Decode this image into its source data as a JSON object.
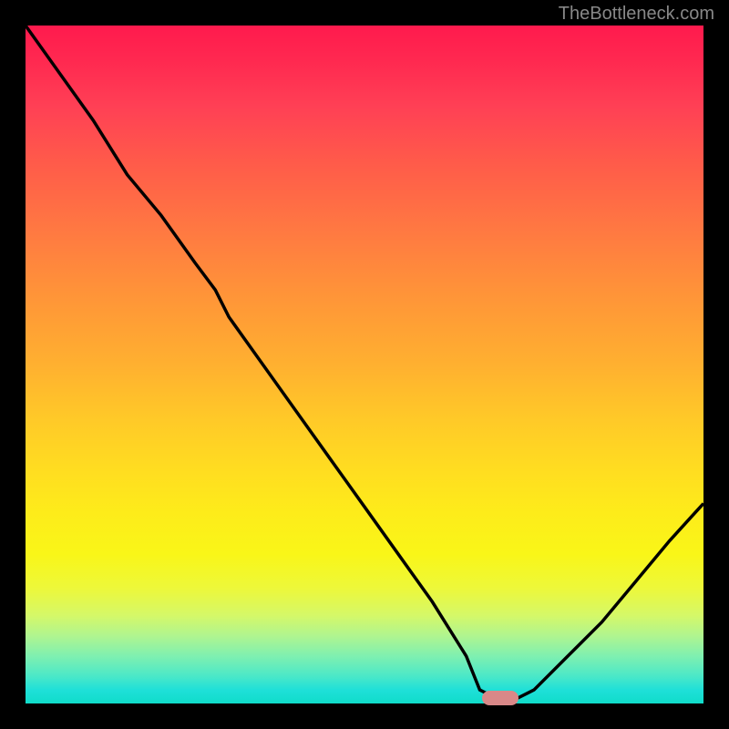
{
  "watermark": "TheBottleneck.com",
  "chart_data": {
    "type": "line",
    "title": "",
    "xlabel": "",
    "ylabel": "",
    "x": [
      0,
      5,
      10,
      15,
      20,
      25,
      28,
      30,
      35,
      40,
      45,
      50,
      55,
      60,
      65,
      67,
      70,
      72,
      75,
      80,
      85,
      90,
      95,
      100
    ],
    "values": [
      100,
      93,
      86,
      78,
      72,
      65,
      61,
      57,
      50,
      43,
      36,
      29,
      22,
      15,
      7,
      2,
      0.5,
      0.5,
      2,
      7,
      12,
      18,
      24,
      29.5
    ],
    "xlim": [
      0,
      100
    ],
    "ylim": [
      0,
      100
    ],
    "marker": {
      "x": 70,
      "y": 0.8
    },
    "gradient_colors": {
      "top": "#ff1a4d",
      "middle": "#ffc928",
      "bottom": "#10dcca"
    }
  }
}
